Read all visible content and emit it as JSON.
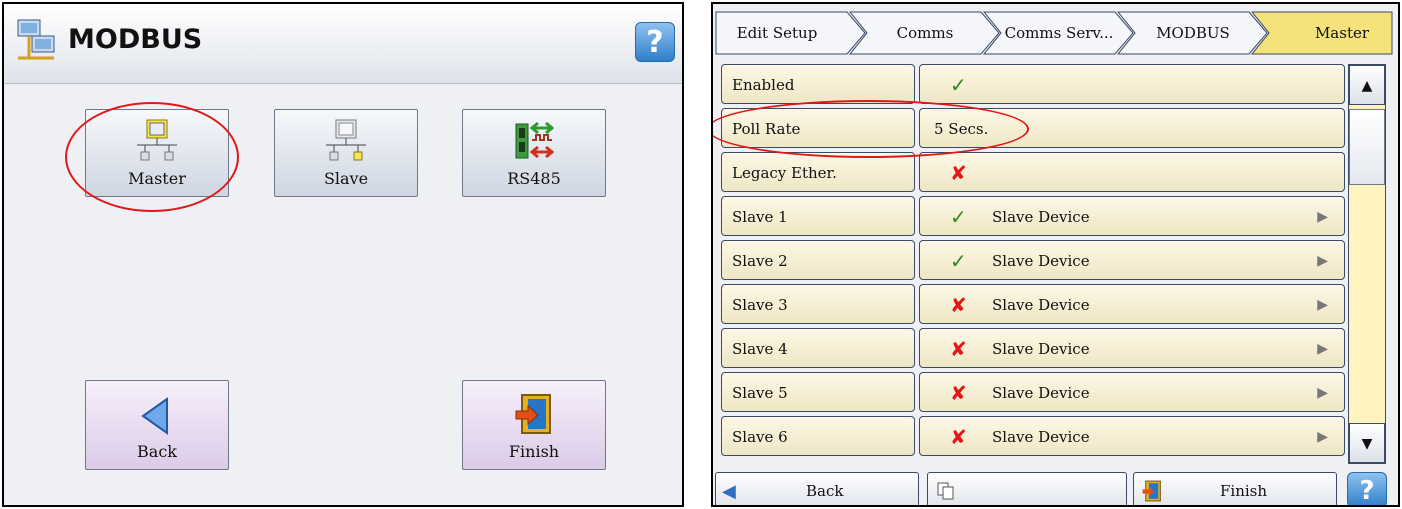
{
  "left": {
    "title": "MODBUS",
    "help": "?",
    "tiles": [
      {
        "label": "Master",
        "icon": "modbus-master-icon"
      },
      {
        "label": "Slave",
        "icon": "modbus-slave-icon"
      },
      {
        "label": "RS485",
        "icon": "rs485-icon"
      }
    ],
    "back_label": "Back",
    "finish_label": "Finish"
  },
  "right": {
    "breadcrumbs": [
      "Edit Setup",
      "Comms",
      "Comms Serv...",
      "MODBUS",
      "Master"
    ],
    "rows": [
      {
        "label": "Enabled",
        "status": "tick",
        "value": ""
      },
      {
        "label": "Poll Rate",
        "status": "",
        "value": "5 Secs."
      },
      {
        "label": "Legacy Ether.",
        "status": "cross",
        "value": ""
      },
      {
        "label": "Slave 1",
        "status": "tick",
        "value": "Slave Device"
      },
      {
        "label": "Slave 2",
        "status": "tick",
        "value": "Slave Device"
      },
      {
        "label": "Slave 3",
        "status": "cross",
        "value": "Slave Device"
      },
      {
        "label": "Slave 4",
        "status": "cross",
        "value": "Slave Device"
      },
      {
        "label": "Slave 5",
        "status": "cross",
        "value": "Slave Device"
      },
      {
        "label": "Slave 6",
        "status": "cross",
        "value": "Slave Device"
      }
    ],
    "back_label": "Back",
    "finish_label": "Finish",
    "help": "?"
  },
  "colors": {
    "highlight": "#e01818",
    "tick": "#2e8a20",
    "cross": "#e01818",
    "active_crumb": "#f5e27a"
  }
}
